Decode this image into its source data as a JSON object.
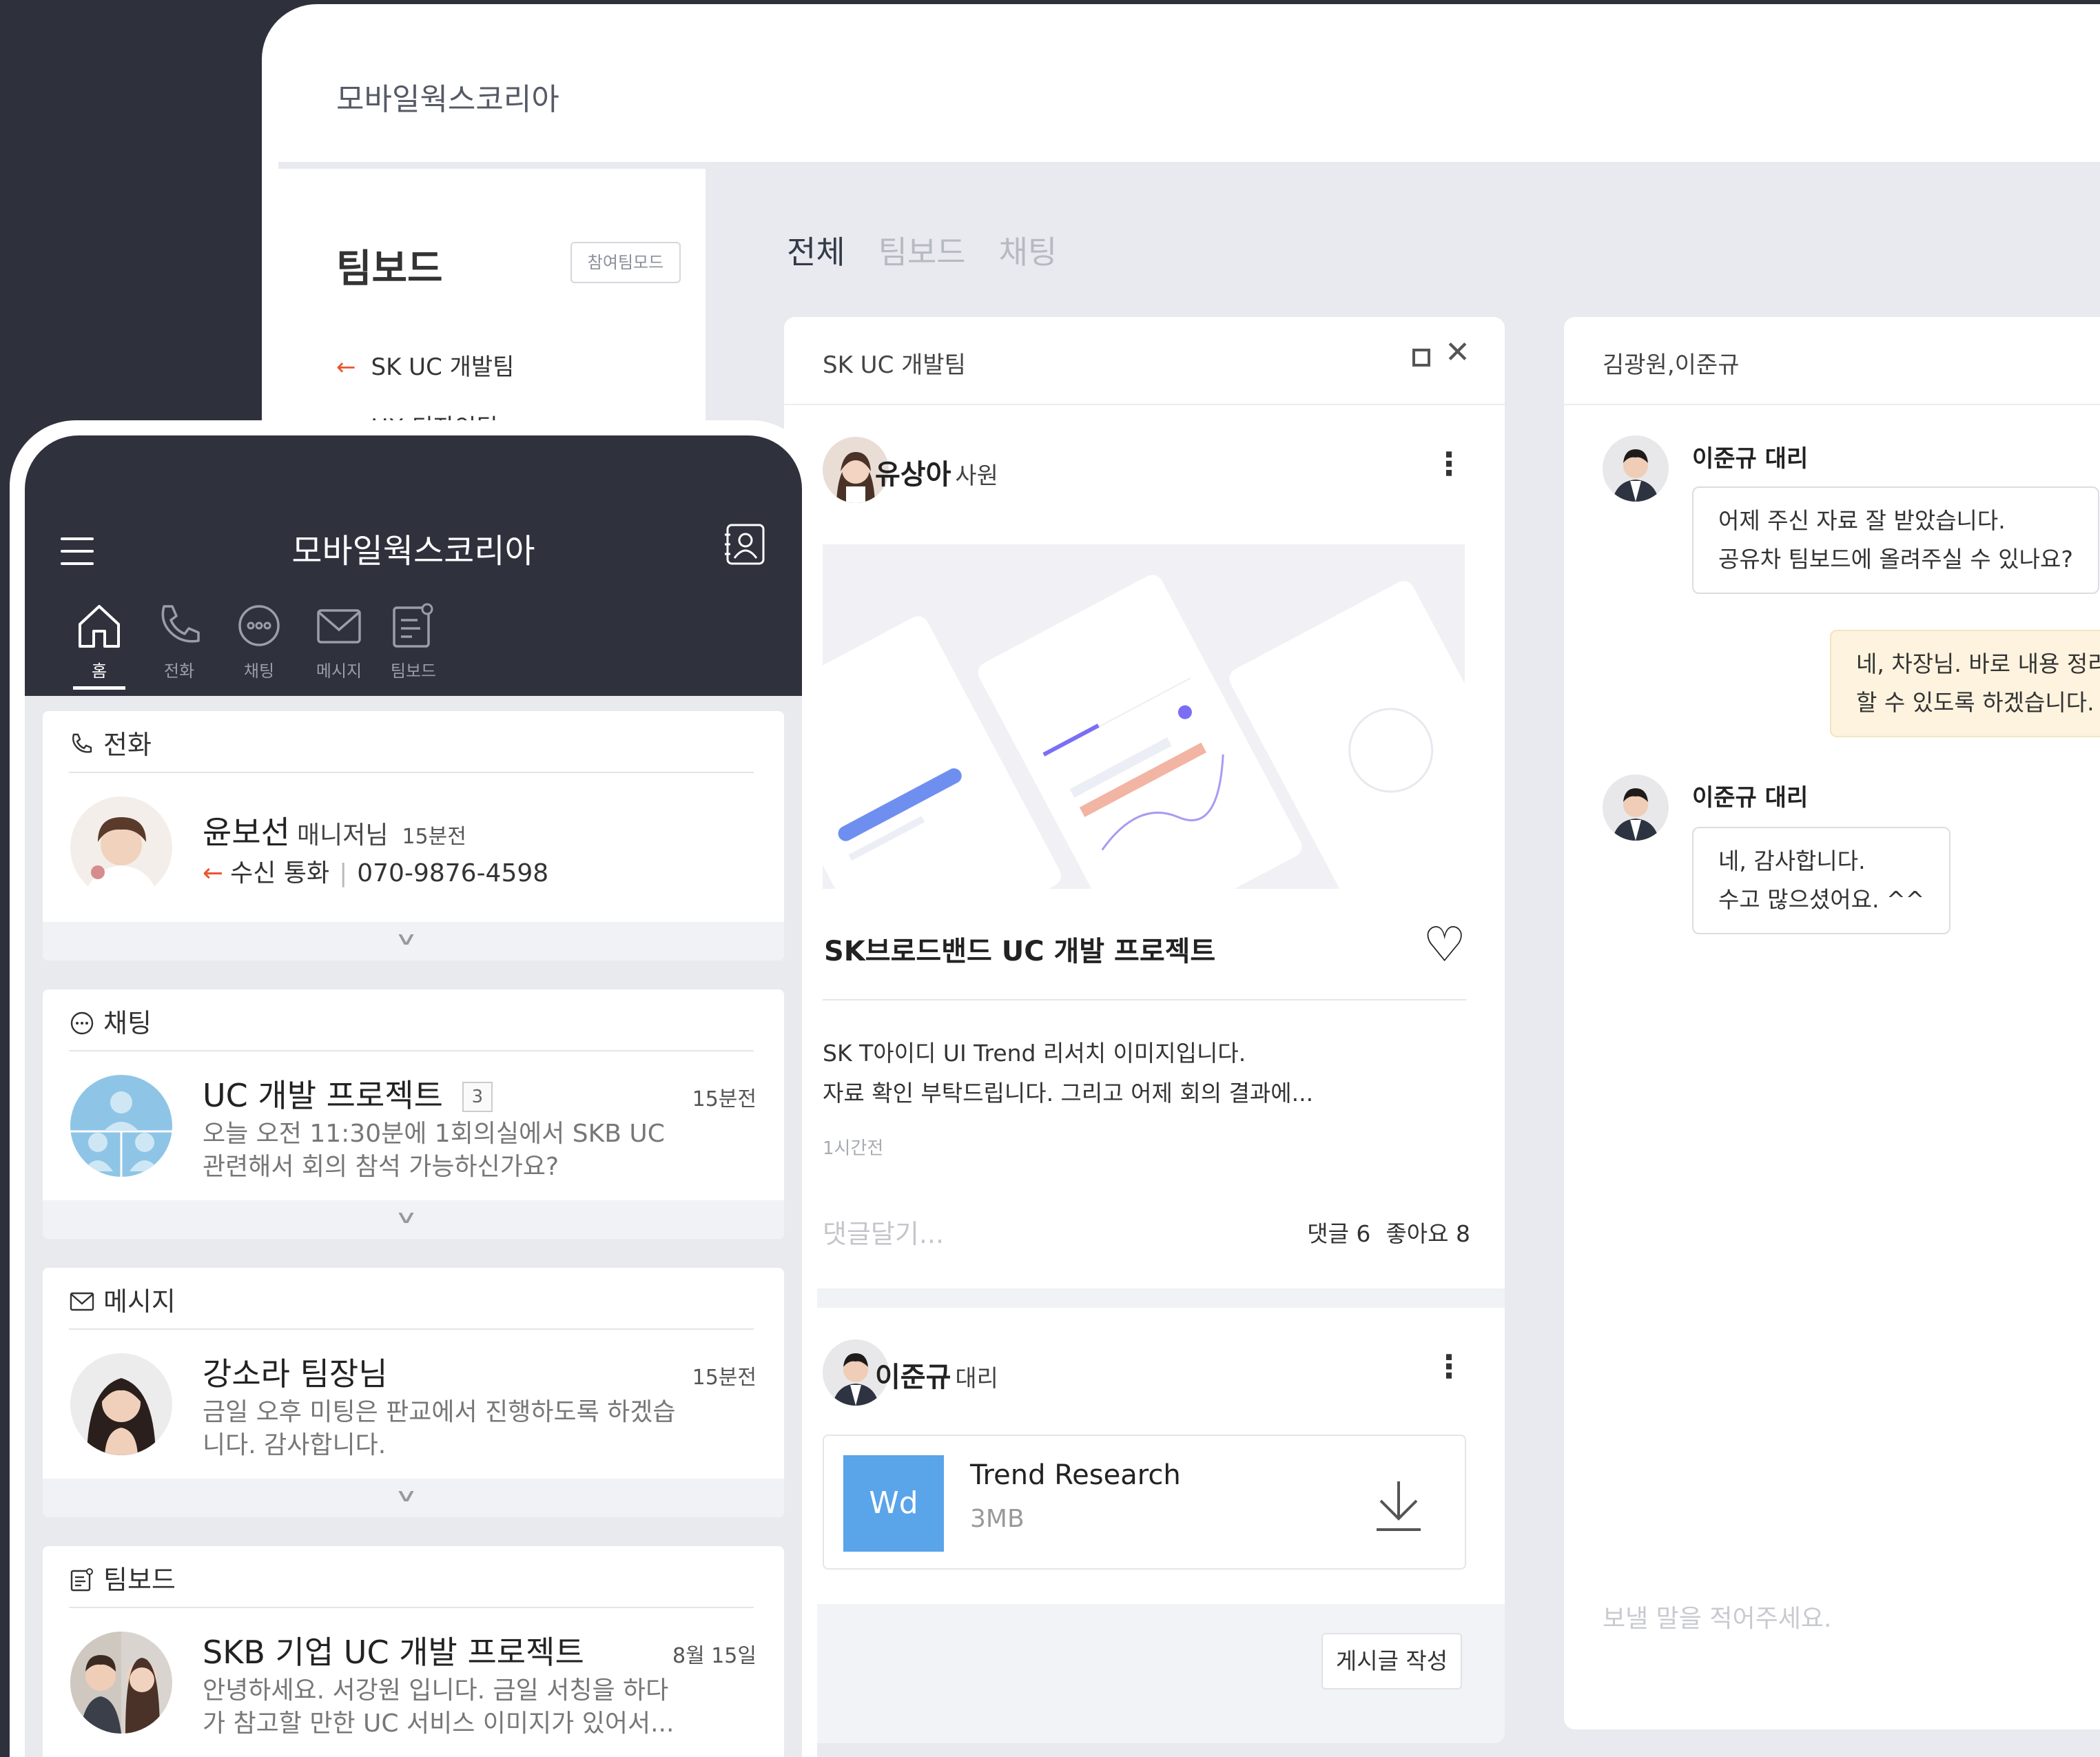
{
  "desktop": {
    "app_title": "모바일웍스코리아",
    "sidebar": {
      "title": "팀보드",
      "mode_button": "참여팀모드",
      "items": [
        {
          "label": "SK UC 개발팀"
        },
        {
          "label": "UX 디자인팀"
        }
      ]
    },
    "tabs": [
      {
        "label": "전체",
        "active": true
      },
      {
        "label": "팀보드",
        "active": false
      },
      {
        "label": "채팅",
        "active": false
      }
    ],
    "board_panel": {
      "title": "SK UC 개발팀",
      "post": {
        "author": "유상아",
        "author_rank": "사원",
        "title": "SK브로드밴드 UC 개발 프로젝트",
        "body_line1": "SK T아이디 UI Trend 리서치 이미지입니다.",
        "body_line2": "자료 확인 부탁드립니다. 그리고 어제 회의 결과에...",
        "time": "1시간전",
        "comment_placeholder": "댓글달기...",
        "comments": "댓글 6",
        "likes": "좋아요 8"
      },
      "post2": {
        "author": "이준규",
        "author_rank": "대리",
        "file_type": "Wd",
        "file_name": "Trend Research",
        "file_size": "3MB"
      },
      "write_button": "게시글 작성"
    },
    "chat_panel": {
      "title": "김광원,이준규",
      "messages": [
        {
          "sender": "이준규 대리",
          "line1": "어제 주신 자료 잘 받았습니다.",
          "line2": "공유차 팀보드에 올려주실 수 있나요?"
        },
        {
          "sender": "",
          "line1": "네, 차장님. 바로 내용 정리",
          "line2": "할 수 있도록 하겠습니다."
        },
        {
          "sender": "이준규 대리",
          "line1": "네, 감사합니다.",
          "line2": "수고 많으셨어요. ^^"
        }
      ],
      "input_placeholder": "보낼 말을 적어주세요."
    }
  },
  "phone": {
    "title": "모바일웍스코리아",
    "nav": [
      {
        "label": "홈",
        "icon": "home-icon",
        "active": true
      },
      {
        "label": "전화",
        "icon": "phone-icon",
        "active": false
      },
      {
        "label": "채팅",
        "icon": "chat-icon",
        "active": false
      },
      {
        "label": "메시지",
        "icon": "mail-icon",
        "active": false
      },
      {
        "label": "팀보드",
        "icon": "board-icon",
        "active": false
      }
    ],
    "call_card": {
      "header": "전화",
      "name": "윤보선",
      "rank": "매니저님",
      "time": "15분전",
      "call_type": "수신 통화",
      "number": "070-9876-4598"
    },
    "chat_card": {
      "header": "채팅",
      "name": "UC 개발 프로젝트",
      "badge": "3",
      "time": "15분전",
      "desc_line1": "오늘 오전 11:30분에 1회의실에서 SKB UC",
      "desc_line2": "관련해서 회의 참석 가능하신가요?"
    },
    "message_card": {
      "header": "메시지",
      "name": "강소라 팀장님",
      "time": "15분전",
      "desc_line1": "금일 오후 미팅은 판교에서 진행하도록 하겠습",
      "desc_line2": "니다. 감사합니다."
    },
    "board_card": {
      "header": "팀보드",
      "name": "SKB 기업 UC 개발 프로젝트",
      "time": "8월 15일",
      "desc_line1": "안녕하세요. 서강원 입니다. 금일 서칭을 하다",
      "desc_line2": "가 참고할 만한 UC 서비스 이미지가 있어서..."
    }
  },
  "colors": {
    "dark_header": "#2f323d",
    "background": "#e9eaee",
    "accent_arrow": "#e8562f",
    "file_blue": "#5aa4ea",
    "my_bubble": "#fdf3de"
  }
}
